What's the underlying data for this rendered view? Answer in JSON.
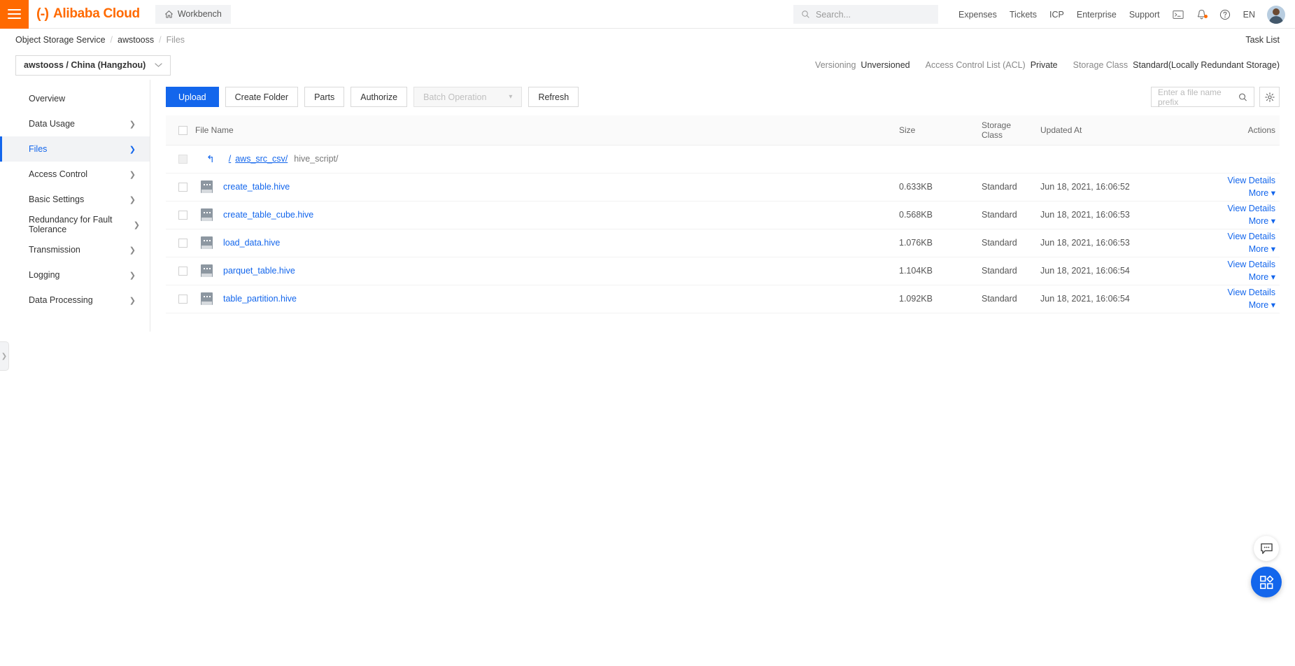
{
  "header": {
    "menu_icon": "hamburger-icon",
    "brand": "Alibaba Cloud",
    "workbench_label": "Workbench",
    "search_placeholder": "Search...",
    "links": [
      "Expenses",
      "Tickets",
      "ICP",
      "Enterprise",
      "Support"
    ],
    "console_icon": "terminal-icon",
    "bell_icon": "bell-icon",
    "help_icon": "help-icon",
    "language": "EN"
  },
  "breadcrumb": {
    "items": [
      "Object Storage Service",
      "awstooss",
      "Files"
    ],
    "separator": "/",
    "task_list": "Task List"
  },
  "bucket": {
    "name": "awstooss / China (Hangzhou)",
    "meta": [
      {
        "label": "Versioning",
        "value": "Unversioned"
      },
      {
        "label": "Access Control List (ACL)",
        "value": "Private"
      },
      {
        "label": "Storage Class",
        "value": "Standard(Locally Redundant Storage)"
      }
    ]
  },
  "sidebar": {
    "items": [
      {
        "label": "Overview",
        "chevron": false,
        "active": false
      },
      {
        "label": "Data Usage",
        "chevron": true,
        "active": false
      },
      {
        "label": "Files",
        "chevron": true,
        "active": true
      },
      {
        "label": "Access Control",
        "chevron": true,
        "active": false
      },
      {
        "label": "Basic Settings",
        "chevron": true,
        "active": false
      },
      {
        "label": "Redundancy for Fault Tolerance",
        "chevron": true,
        "active": false
      },
      {
        "label": "Transmission",
        "chevron": true,
        "active": false
      },
      {
        "label": "Logging",
        "chevron": true,
        "active": false
      },
      {
        "label": "Data Processing",
        "chevron": true,
        "active": false
      }
    ]
  },
  "toolbar": {
    "upload": "Upload",
    "create_folder": "Create Folder",
    "parts": "Parts",
    "authorize": "Authorize",
    "batch_operation": "Batch Operation",
    "refresh": "Refresh",
    "search_placeholder": "Enter a file name prefix",
    "settings_icon": "gear-icon"
  },
  "table": {
    "columns": {
      "file_name": "File Name",
      "size": "Size",
      "storage_class_line1": "Storage",
      "storage_class_line2": "Class",
      "updated_at": "Updated At",
      "actions": "Actions"
    },
    "path_row": {
      "root": "/",
      "parent": "aws_src_csv/",
      "current": "hive_script/"
    },
    "rows": [
      {
        "name": "create_table.hive",
        "size": "0.633KB",
        "storage_class": "Standard",
        "updated_at": "Jun 18, 2021, 16:06:52",
        "view": "View Details",
        "more": "More"
      },
      {
        "name": "create_table_cube.hive",
        "size": "0.568KB",
        "storage_class": "Standard",
        "updated_at": "Jun 18, 2021, 16:06:53",
        "view": "View Details",
        "more": "More"
      },
      {
        "name": "load_data.hive",
        "size": "1.076KB",
        "storage_class": "Standard",
        "updated_at": "Jun 18, 2021, 16:06:53",
        "view": "View Details",
        "more": "More"
      },
      {
        "name": "parquet_table.hive",
        "size": "1.104KB",
        "storage_class": "Standard",
        "updated_at": "Jun 18, 2021, 16:06:54",
        "view": "View Details",
        "more": "More"
      },
      {
        "name": "table_partition.hive",
        "size": "1.092KB",
        "storage_class": "Standard",
        "updated_at": "Jun 18, 2021, 16:06:54",
        "view": "View Details",
        "more": "More"
      }
    ]
  },
  "floating": {
    "chat_icon": "chat-icon",
    "apps_icon": "apps-grid-icon"
  },
  "colors": {
    "brand_orange": "#ff6a00",
    "primary_blue": "#1366ec",
    "link_blue": "#1366ec"
  }
}
